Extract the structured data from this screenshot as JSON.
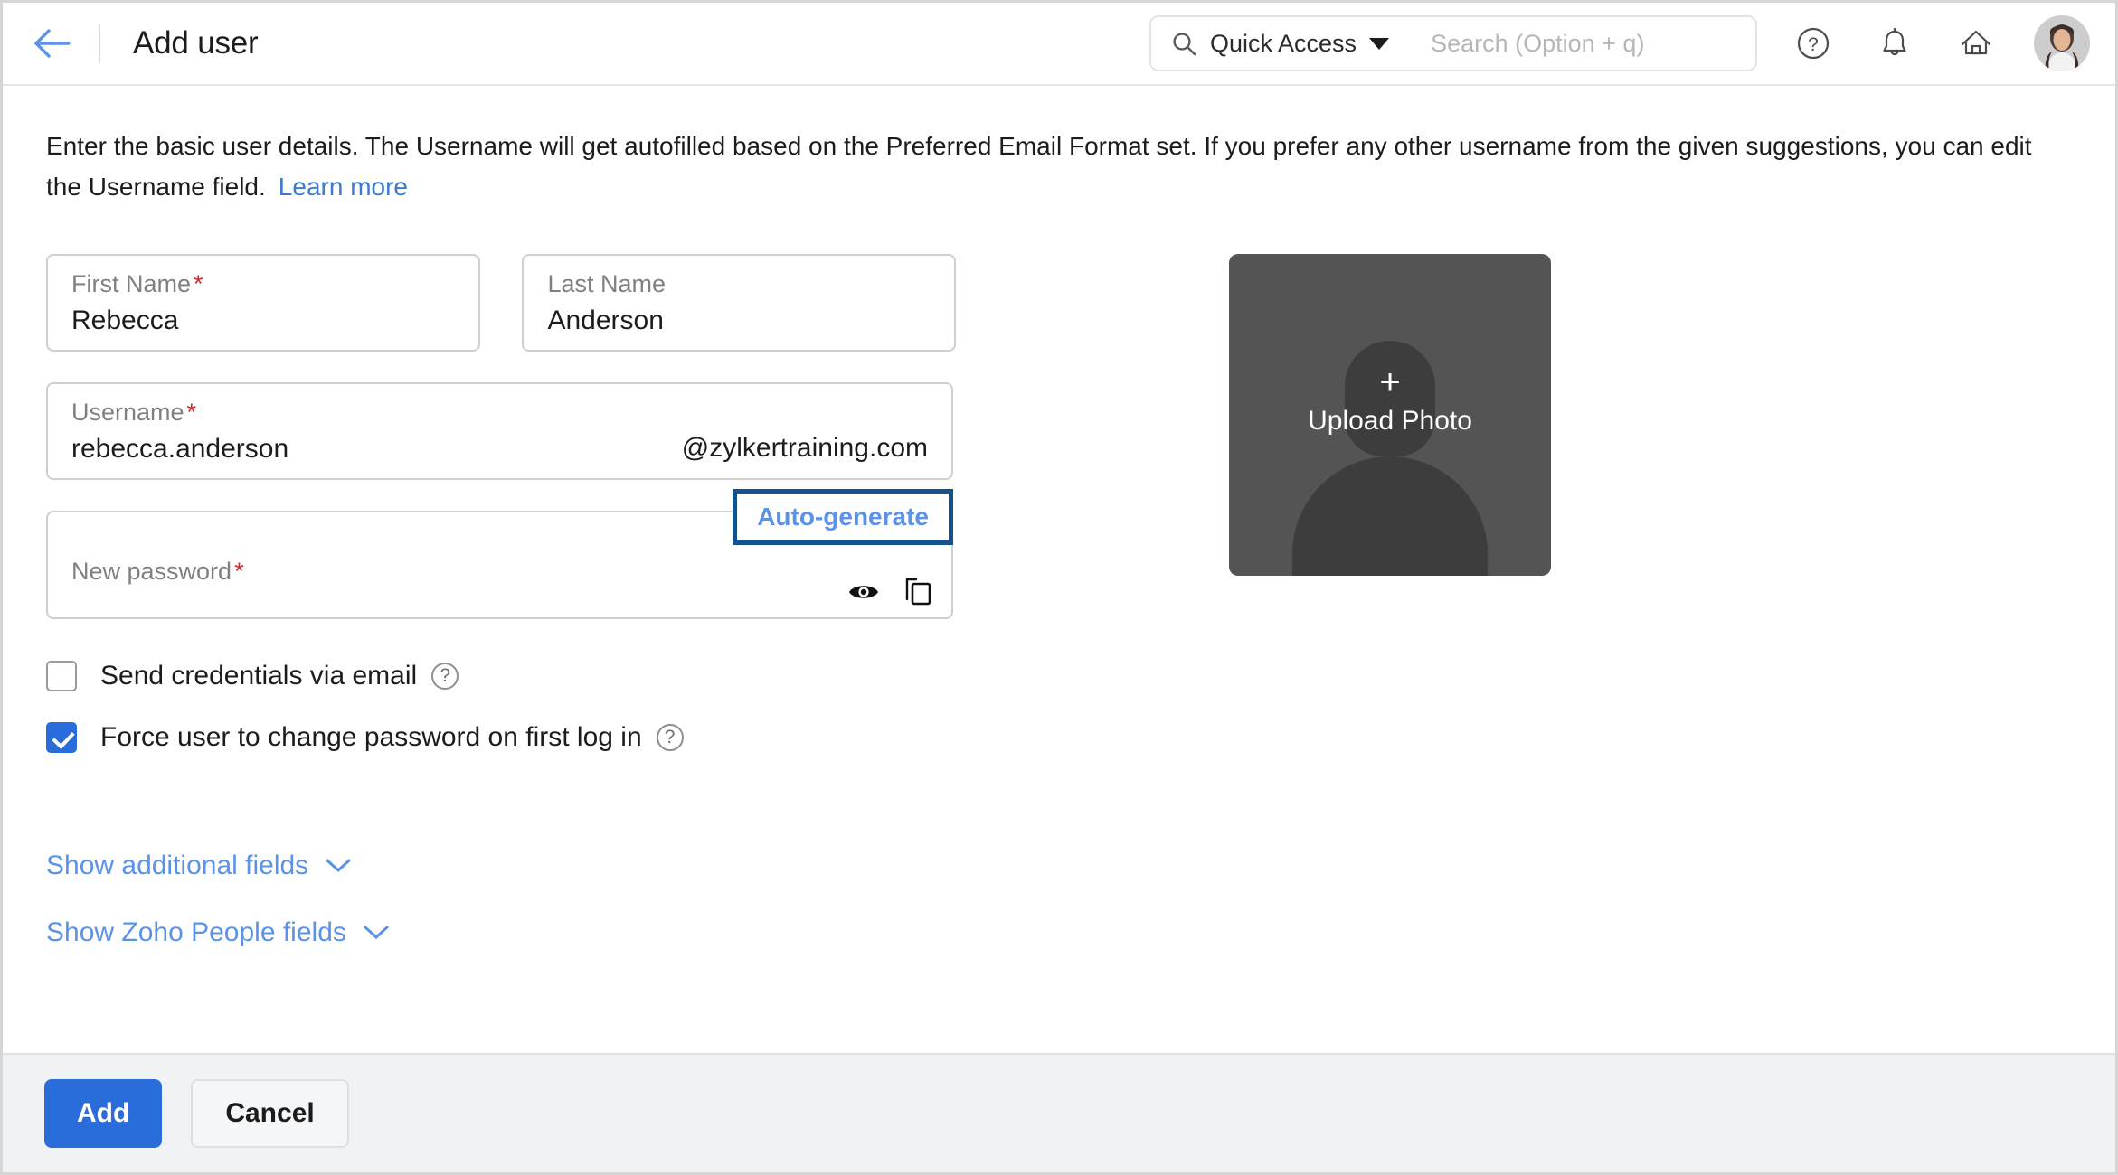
{
  "header": {
    "back_icon": "arrow-left-icon",
    "title": "Add user",
    "search": {
      "icon": "search-icon",
      "quick_access_label": "Quick Access",
      "placeholder": "Search (Option + q)",
      "value": ""
    },
    "icons": [
      {
        "name": "help-icon",
        "glyph": "?"
      },
      {
        "name": "notifications-bell-icon",
        "glyph": "bell"
      },
      {
        "name": "home-icon",
        "glyph": "home"
      }
    ],
    "avatar_name": "user-avatar"
  },
  "intro": {
    "text": "Enter the basic user details. The Username will get autofilled based on the Preferred Email Format set. If you prefer any other username from the given suggestions, you can edit the Username field.",
    "link_label": "Learn more"
  },
  "form": {
    "first_name": {
      "label": "First Name",
      "required": "*",
      "value": "Rebecca",
      "placeholder": "First Name"
    },
    "last_name": {
      "label": "Last Name",
      "required": "",
      "value": "Anderson",
      "placeholder": "Last Name"
    },
    "username": {
      "label": "Username",
      "required": "*",
      "value": "rebecca.anderson",
      "placeholder": "Username",
      "domain_suffix": "@zylkertraining.com"
    },
    "password": {
      "label": "New password",
      "required": "*",
      "value": "",
      "placeholder": "",
      "auto_generate_label": "Auto-generate",
      "highlight_color": "#15508f",
      "link_color": "#5b93e8",
      "show_icon": "eye-icon",
      "copy_icon": "copy-icon"
    },
    "checkboxes": [
      {
        "label": "Send credentials via email",
        "checked": false,
        "help": "?"
      },
      {
        "label": "Force user to change password on first log in",
        "checked": true,
        "help": "?"
      }
    ],
    "expanders": [
      {
        "label": "Show additional fields",
        "icon": "chevron-down-icon"
      },
      {
        "label": "Show Zoho People fields",
        "icon": "chevron-down-icon"
      }
    ]
  },
  "photo": {
    "plus": "+",
    "label": "Upload Photo",
    "background_color": "#545454"
  },
  "footer": {
    "add_label": "Add",
    "cancel_label": "Cancel",
    "primary_color": "#2b6cdb"
  }
}
